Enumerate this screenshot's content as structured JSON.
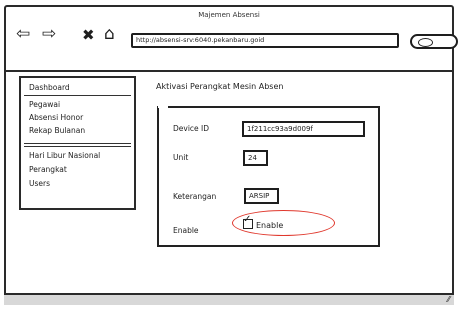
{
  "window": {
    "title": "Majemen Absensi"
  },
  "toolbar": {
    "back_icon": "⇦",
    "forward_icon": "⇨",
    "stop_icon": "✖",
    "home_icon": "⌂",
    "url": "http://absensi-srv:6040.pekanbaru.goid"
  },
  "sidebar": {
    "items": [
      {
        "label": "Dashboard"
      },
      {
        "label": "Pegawai"
      },
      {
        "label": "Absensi Honor"
      },
      {
        "label": "Rekap Bulanan"
      },
      {
        "label": "Hari Libur Nasional"
      },
      {
        "label": "Perangkat"
      },
      {
        "label": "Users"
      }
    ]
  },
  "main": {
    "title": "Aktivasi Perangkat Mesin Absen",
    "form": {
      "device_id_label": "Device ID",
      "device_id_value": "1f211cc93a9d009f",
      "unit_label": "Unit",
      "unit_value": "24",
      "keterangan_label": "Keterangan",
      "keterangan_value": "ARSIP",
      "enable_label": "Enable",
      "enable_checkbox_label": "Enable",
      "enable_checked": true
    }
  },
  "colors": {
    "highlight": "#e0382d",
    "status_bar": "#d8d8d8"
  }
}
